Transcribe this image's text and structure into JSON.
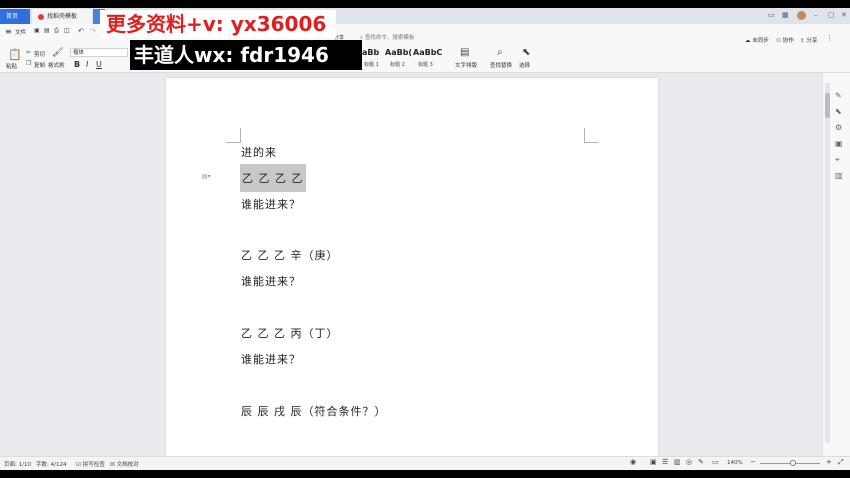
{
  "tabs": {
    "home": "首页",
    "doc": "找稻壳模板"
  },
  "menu": {
    "file": "文件"
  },
  "toolbar": {
    "paste": "粘贴",
    "cut": "剪切",
    "copy": "复制",
    "format_painter": "格式刷",
    "font_name": "楷体",
    "bold": "B",
    "italic": "I",
    "underline": "U",
    "heading1_sample": "aBb",
    "heading1_label": "标题 1",
    "heading2_sample": "AaBb(",
    "heading2_label": "标题 2",
    "heading3_sample": "AaBbC",
    "heading3_label": "标题 3",
    "text_layout": "文字排版",
    "find_replace": "查找替换",
    "select": "选择",
    "search_placeholder": "查找命令、搜索模板",
    "share_small": "分享",
    "sync": "未同步",
    "collab": "协作",
    "share": "分享"
  },
  "document": {
    "lines": [
      "进的来",
      "乙 乙 乙 乙",
      "谁能进来？",
      "乙 乙 乙 辛（庚）",
      "谁能进来？",
      "乙 乙 乙 丙（丁）",
      "谁能进来？",
      "辰 辰 戌 辰（符合条件？）"
    ]
  },
  "statusbar": {
    "page": "页面: 1/10",
    "words": "字数: 4/124",
    "spell": "拼写检查",
    "proof": "文档校对",
    "zoom": "140%"
  },
  "watermark": {
    "line1": "更多资料+v: yx36006",
    "line2": "丰道人wx: fdr1946"
  }
}
